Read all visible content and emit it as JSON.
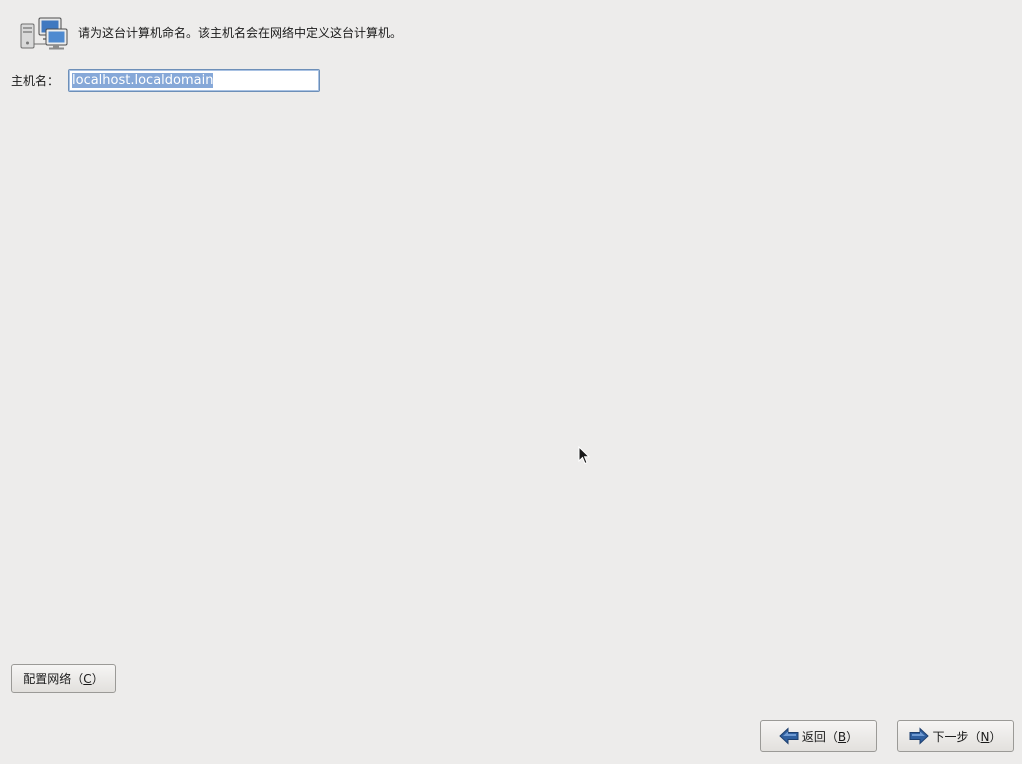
{
  "header": {
    "icon": "network-computers-icon",
    "text": "请为这台计算机命名。该主机名会在网络中定义这台计算机。"
  },
  "hostname": {
    "label": "主机名：",
    "value": "localhost.localdomain"
  },
  "buttons": {
    "configure_network": {
      "text": "配置网络（",
      "mnemonic": "C",
      "suffix": "）"
    },
    "back": {
      "text": "返回（",
      "mnemonic": "B",
      "suffix": "）",
      "icon": "left-arrow-icon"
    },
    "next": {
      "text": "下一步（",
      "mnemonic": "N",
      "suffix": "）",
      "icon": "right-arrow-icon"
    }
  },
  "colors": {
    "background": "#edeceb",
    "selection": "#86a8d8",
    "arrow_blue": "#2f5f9f"
  }
}
